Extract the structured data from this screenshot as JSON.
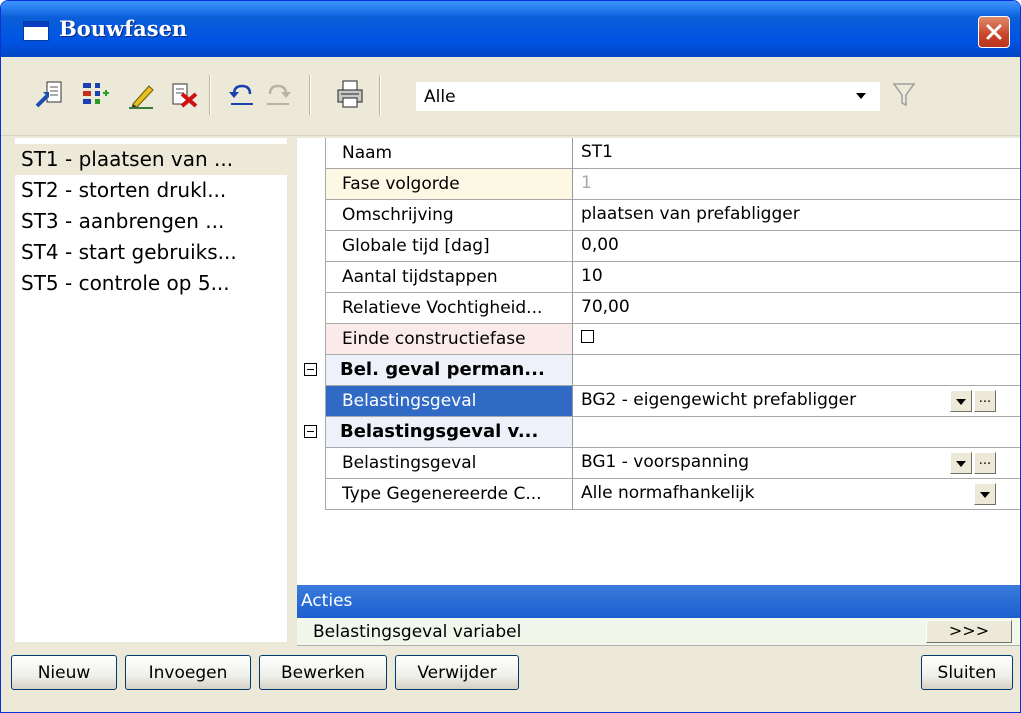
{
  "window": {
    "title": "Bouwfasen",
    "icon": "window-icon"
  },
  "toolbar": {
    "buttons": [
      "import-icon",
      "columns-icon",
      "edit-pencil-icon",
      "delete-icon",
      "undo-icon",
      "redo-icon",
      "print-icon"
    ],
    "filter": {
      "value": "Alle"
    },
    "filter_icon": "funnel-icon"
  },
  "list": {
    "items": [
      {
        "label": "ST1 - plaatsen van ...",
        "selected": true
      },
      {
        "label": "ST2 - storten drukl..."
      },
      {
        "label": "ST3 - aanbrengen ..."
      },
      {
        "label": "ST4 - start gebruiks..."
      },
      {
        "label": "ST5 - controle op 5..."
      }
    ]
  },
  "properties": {
    "rows": [
      {
        "name": "Naam",
        "value": "ST1"
      },
      {
        "name": "Fase volgorde",
        "value": "1"
      },
      {
        "name": "Omschrijving",
        "value": "plaatsen van prefabligger"
      },
      {
        "name": "Globale tijd [dag]",
        "value": "0,00"
      },
      {
        "name": "Aantal tijdstappen",
        "value": "10"
      },
      {
        "name": "Relatieve Vochtigheid...",
        "value": "70,00"
      },
      {
        "name": "Einde constructiefase",
        "value": "",
        "checked": false
      },
      {
        "name": "Bel. geval perman...",
        "value": "",
        "category": true
      },
      {
        "name": "Belastingsgeval",
        "value": "BG2 - eigengewicht prefabligger",
        "selected": true
      },
      {
        "name": "Belastingsgeval v...",
        "value": "",
        "category": true
      },
      {
        "name": "Belastingsgeval",
        "value": "BG1 - voorspanning"
      },
      {
        "name": "Type Gegenereerde C...",
        "value": "Alle normafhankelijk"
      }
    ],
    "ellipsis_label": "..."
  },
  "actions": {
    "header": "Acties",
    "item_label": "Belastingsgeval variabel",
    "button_label": ">>>"
  },
  "buttons": {
    "new": "Nieuw",
    "insert": "Invoegen",
    "edit": "Bewerken",
    "delete": "Verwijder",
    "close": "Sluiten"
  },
  "colors": {
    "titlebar": "#0054e3",
    "selection": "#316ac5",
    "row_readonly": "#fdf8e4",
    "row_warning": "#fbeaea",
    "row_category": "#eef0fa",
    "actions_header": "#2a6fd6"
  }
}
